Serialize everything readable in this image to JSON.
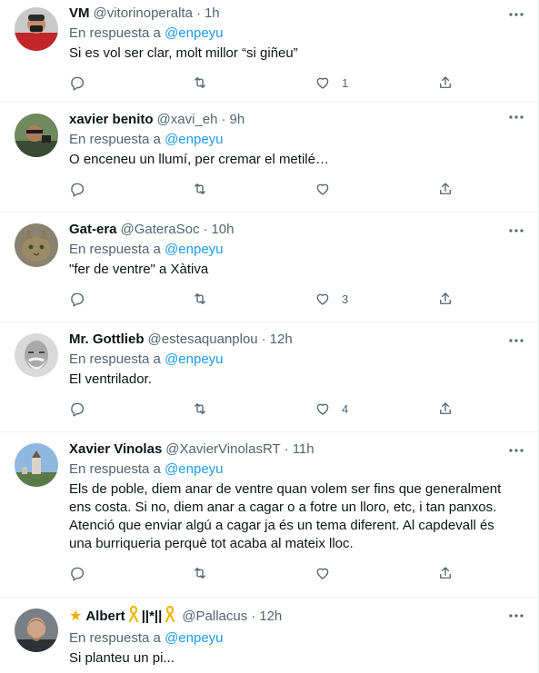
{
  "tweets": [
    {
      "name": "VM",
      "handle": "@vitorinoperalta",
      "sep": "·",
      "time": "1h",
      "reply_prefix": "En respuesta a",
      "mention": "@enpeyu",
      "text": "Si es vol ser clar, molt millor “si giñeu”",
      "likes": "1"
    },
    {
      "name": "xavier benito",
      "handle": "@xavi_eh",
      "sep": "·",
      "time": "9h",
      "reply_prefix": "En respuesta a",
      "mention": "@enpeyu",
      "text": "O enceneu un llumí, per cremar el metilé…",
      "likes": ""
    },
    {
      "name": "Gat-era",
      "handle": "@GateraSoc",
      "sep": "·",
      "time": "10h",
      "reply_prefix": "En respuesta a",
      "mention": "@enpeyu",
      "text": "\"fer de ventre\" a Xàtiva",
      "likes": "3"
    },
    {
      "name": "Mr. Gottlieb",
      "handle": "@estesaquanplou",
      "sep": "·",
      "time": "12h",
      "reply_prefix": "En respuesta a",
      "mention": "@enpeyu",
      "text": "El ventrilador.",
      "likes": "4"
    },
    {
      "name": "Xavier Vinolas",
      "handle": "@XavierVinolasRT",
      "sep": "·",
      "time": "11h",
      "reply_prefix": "En respuesta a",
      "mention": "@enpeyu",
      "text": "Els de poble, diem anar de ventre quan volem ser fins que generalment ens costa. Si no, diem anar a cagar o a fotre un lloro, etc, i tan panxos. Atenció que enviar algú a cagar ja és un tema diferent. Al capdevall és una burriqueria perquè tot acaba al mateix lloc.",
      "likes": ""
    },
    {
      "name": "Albert",
      "name_suffix": "||*||",
      "handle": "@Pallacus",
      "sep": "·",
      "time": "12h",
      "reply_prefix": "En respuesta a",
      "mention": "@enpeyu",
      "text": "Si planteu un pi...",
      "likes": ""
    }
  ],
  "icons": {
    "more": "more-horizontal-icon",
    "reply": "reply-bubble-icon",
    "retweet": "retweet-icon",
    "like": "heart-icon",
    "share": "share-upload-icon",
    "star": "star-icon",
    "ribbon": "yellow-ribbon-icon"
  },
  "colors": {
    "accent": "#1d9bf0",
    "muted": "#536471",
    "text": "#0f1419",
    "border": "#eff3f4"
  }
}
